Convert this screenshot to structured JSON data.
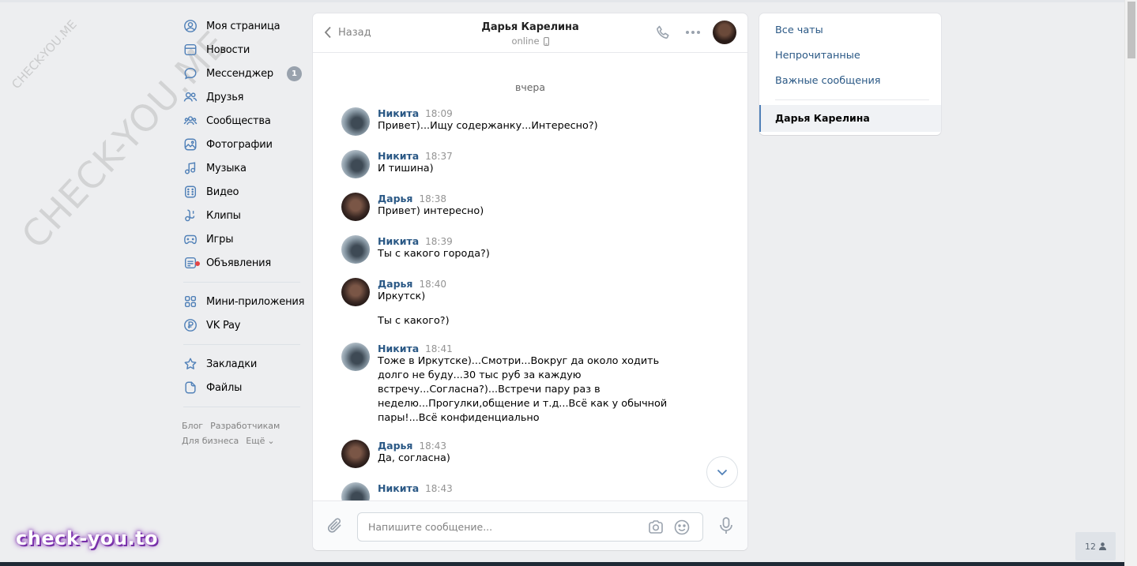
{
  "nav": {
    "items": [
      {
        "label": "Моя страница",
        "icon": "user-circle-icon"
      },
      {
        "label": "Новости",
        "icon": "newspaper-icon"
      },
      {
        "label": "Мессенджер",
        "icon": "message-icon",
        "badge": "1"
      },
      {
        "label": "Друзья",
        "icon": "friends-icon"
      },
      {
        "label": "Сообщества",
        "icon": "communities-icon"
      },
      {
        "label": "Фотографии",
        "icon": "photo-icon"
      },
      {
        "label": "Музыка",
        "icon": "music-icon"
      },
      {
        "label": "Видео",
        "icon": "video-icon"
      },
      {
        "label": "Клипы",
        "icon": "clips-icon"
      },
      {
        "label": "Игры",
        "icon": "gamepad-icon"
      },
      {
        "label": "Объявления",
        "icon": "classifieds-icon"
      }
    ],
    "items2": [
      {
        "label": "Мини-приложения",
        "icon": "apps-icon"
      },
      {
        "label": "VK Pay",
        "icon": "vkpay-icon"
      }
    ],
    "items3": [
      {
        "label": "Закладки",
        "icon": "star-icon"
      },
      {
        "label": "Файлы",
        "icon": "file-icon"
      }
    ],
    "footer": {
      "blog": "Блог",
      "devs": "Разработчикам",
      "business": "Для бизнеса",
      "more": "Ещё"
    }
  },
  "chat": {
    "back_label": "Назад",
    "peer_name": "Дарья Карелина",
    "peer_status": "online",
    "day_separator": "вчера",
    "messages": [
      {
        "author": "Никита",
        "time": "18:09",
        "text": "Привет)...Ищу содержанку...Интересно?)"
      },
      {
        "author": "Никита",
        "time": "18:37",
        "text": "И тишина)"
      },
      {
        "author": "Дарья",
        "time": "18:38",
        "text": "Привет) интересно)"
      },
      {
        "author": "Никита",
        "time": "18:39",
        "text": "Ты с какого города?)"
      },
      {
        "author": "Дарья",
        "time": "18:40",
        "text": "Иркутск)",
        "extra": "Ты с какого?)"
      },
      {
        "author": "Никита",
        "time": "18:41",
        "text": "Тоже в Иркутске)...Смотри...Вокруг да около ходить долго не буду...30 тыс руб за каждую встречу...Согласна?)...Встречи пару раз в неделю...Прогулки,общение и т.д...Всё как у обычной пары!...Всё конфиденциально"
      },
      {
        "author": "Дарья",
        "time": "18:43",
        "text": "Да, согласна)"
      },
      {
        "author": "Никита",
        "time": "18:43",
        "text": ""
      }
    ],
    "composer_placeholder": "Напишите сообщение..."
  },
  "right_panel": {
    "all_chats": "Все чаты",
    "unread": "Непрочитанные",
    "important": "Важные сообщения",
    "active_chat": "Дарья Карелина"
  },
  "online_count": "12",
  "watermarks": {
    "diagonal": "CHECK-YOU.ME",
    "small": "CHECK-YOU.ME",
    "brand": "check-you.to"
  },
  "colors": {
    "link": "#2a5885",
    "accent": "#5181b8",
    "badge": "#99a2ad",
    "background": "#edeef0"
  }
}
